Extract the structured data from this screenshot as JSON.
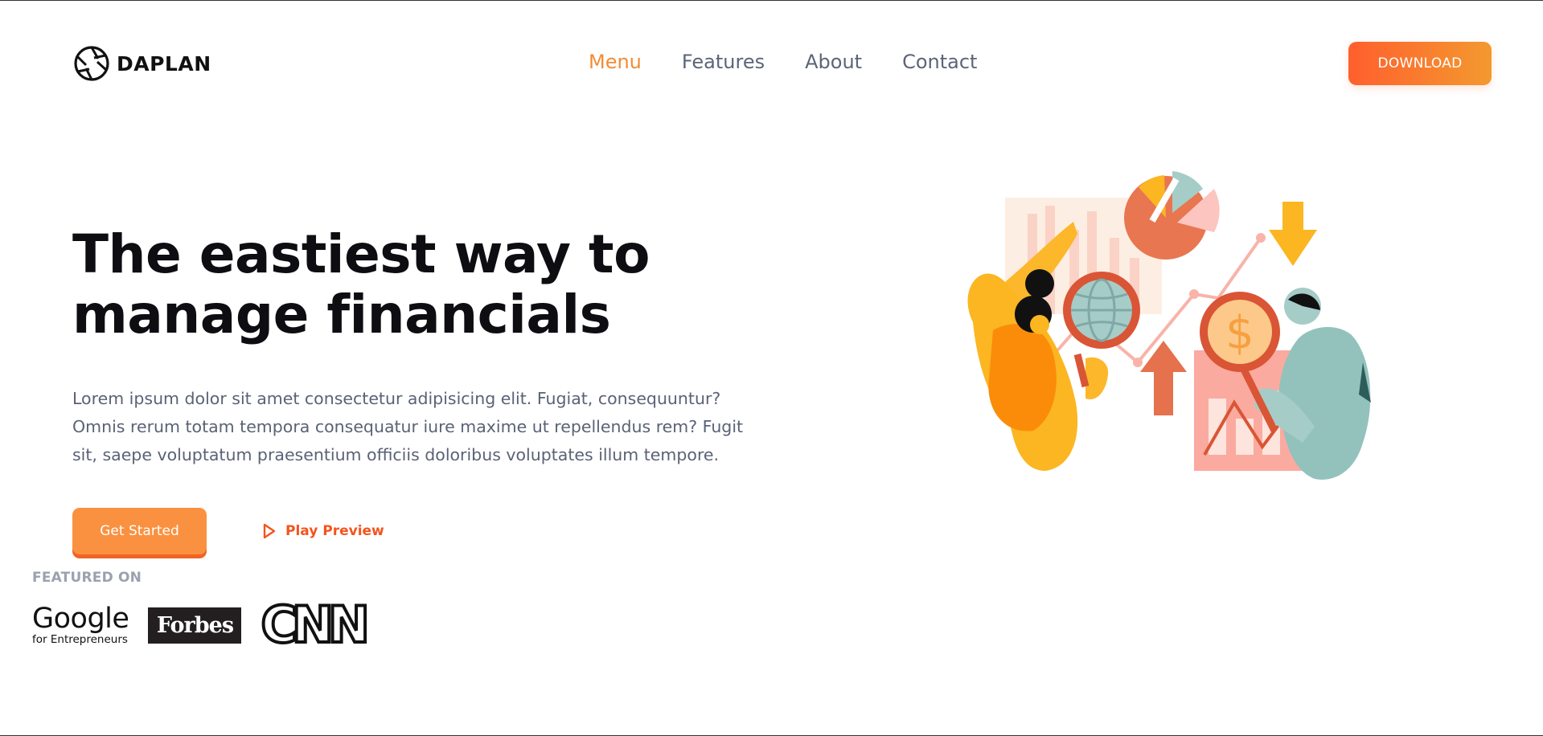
{
  "brand": {
    "name": "DAPLAN",
    "logo_icon": "aperture-icon"
  },
  "nav": {
    "items": [
      {
        "label": "Menu",
        "active": true
      },
      {
        "label": "Features",
        "active": false
      },
      {
        "label": "About",
        "active": false
      },
      {
        "label": "Contact",
        "active": false
      }
    ],
    "active_color": "#f28c35"
  },
  "header": {
    "download_label": "DOWNLOAD"
  },
  "hero": {
    "title_line1": "The eastiest way to",
    "title_line2": "manage financials",
    "description": "Lorem ipsum dolor sit amet consectetur adipisicing elit. Fugiat, consequuntur? Omnis rerum totam tempora consequatur iure maxime ut repellendus rem? Fugit sit, saepe voluptatum praesentium officiis doloribus voluptates illum tempore.",
    "cta_label": "Get Started",
    "play_label": "Play Preview",
    "play_icon": "play-icon",
    "illustration": "financial-analysis-illustration"
  },
  "featured": {
    "label": "FEATURED ON",
    "google": {
      "word": "Google",
      "sub": "for Entrepreneurs"
    },
    "forbes": "Forbes",
    "cnn": "CNN"
  },
  "colors": {
    "accent": "#fa9140",
    "accent_dark": "#f06424",
    "gradient_start": "#ff5f2d",
    "gradient_end": "#f3992f",
    "muted_text": "#5a6275"
  }
}
